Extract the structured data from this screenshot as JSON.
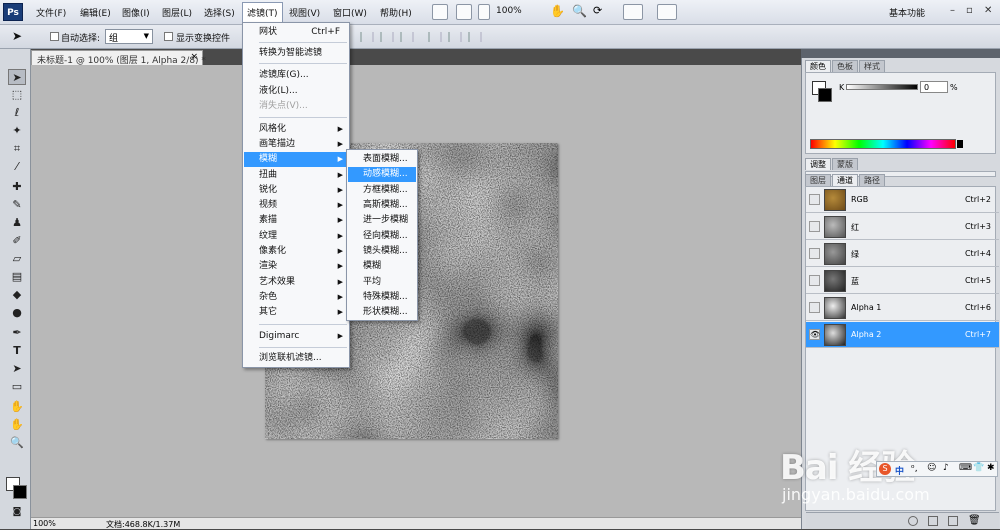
{
  "app": {
    "logo": "Ps"
  },
  "menubar": {
    "items": [
      "文件(F)",
      "编辑(E)",
      "图像(I)",
      "图层(L)",
      "选择(S)",
      "滤镜(T)",
      "视图(V)",
      "窗口(W)",
      "帮助(H)"
    ],
    "zoom": "100%",
    "workspace": "基本功能"
  },
  "options": {
    "auto_select": "自动选择:",
    "group_value": "组",
    "show_transform": "显示变换控件"
  },
  "document": {
    "tab_title": "未标题-1 @ 100% (图层 1, Alpha 2/8) *",
    "status_zoom": "100%",
    "status_doc": "文档:468.8K/1.37M"
  },
  "filter_menu": {
    "last_filter": "网状",
    "last_filter_shortcut": "Ctrl+F",
    "convert_smart": "转换为智能滤镜",
    "gallery": "滤镜库(G)...",
    "liquify": "液化(L)...",
    "vanishing_point": "消失点(V)...",
    "categories": [
      "风格化",
      "画笔描边",
      "模糊",
      "扭曲",
      "锐化",
      "视频",
      "素描",
      "纹理",
      "像素化",
      "渲染",
      "艺术效果",
      "杂色",
      "其它"
    ],
    "digimarc": "Digimarc",
    "browse_online": "浏览联机滤镜..."
  },
  "blur_menu": {
    "items": [
      "表面模糊...",
      "动感模糊...",
      "方框模糊...",
      "高斯模糊...",
      "进一步模糊",
      "径向模糊...",
      "镜头模糊...",
      "模糊",
      "平均",
      "特殊模糊...",
      "形状模糊..."
    ]
  },
  "color_panel": {
    "tabs": [
      "颜色",
      "色板",
      "样式"
    ],
    "k_label": "K",
    "k_value": "0",
    "unit": "%"
  },
  "adjust_panel": {
    "tabs": [
      "调整",
      "蒙版"
    ]
  },
  "channels_panel": {
    "tabs": [
      "图层",
      "通道",
      "路径"
    ],
    "channels": [
      {
        "name": "RGB",
        "shortcut": "Ctrl+2"
      },
      {
        "name": "红",
        "shortcut": "Ctrl+3"
      },
      {
        "name": "绿",
        "shortcut": "Ctrl+4"
      },
      {
        "name": "蓝",
        "shortcut": "Ctrl+5"
      },
      {
        "name": "Alpha 1",
        "shortcut": "Ctrl+6"
      },
      {
        "name": "Alpha 2",
        "shortcut": "Ctrl+7"
      }
    ]
  },
  "watermark": {
    "brand": "Bai 经验",
    "url": "jingyan.baidu.com"
  },
  "ime": {
    "label": "中"
  }
}
